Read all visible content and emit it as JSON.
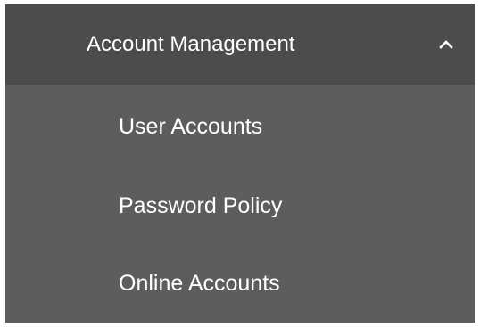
{
  "menu": {
    "header": {
      "label": "Account Management",
      "state_icon": "chevron-up-icon"
    },
    "items": [
      {
        "label": "User Accounts"
      },
      {
        "label": "Password Policy"
      },
      {
        "label": "Online Accounts"
      }
    ]
  },
  "colors": {
    "header_bg": "#4c4c4c",
    "items_bg": "#5d5d5d",
    "text": "#ffffff"
  }
}
